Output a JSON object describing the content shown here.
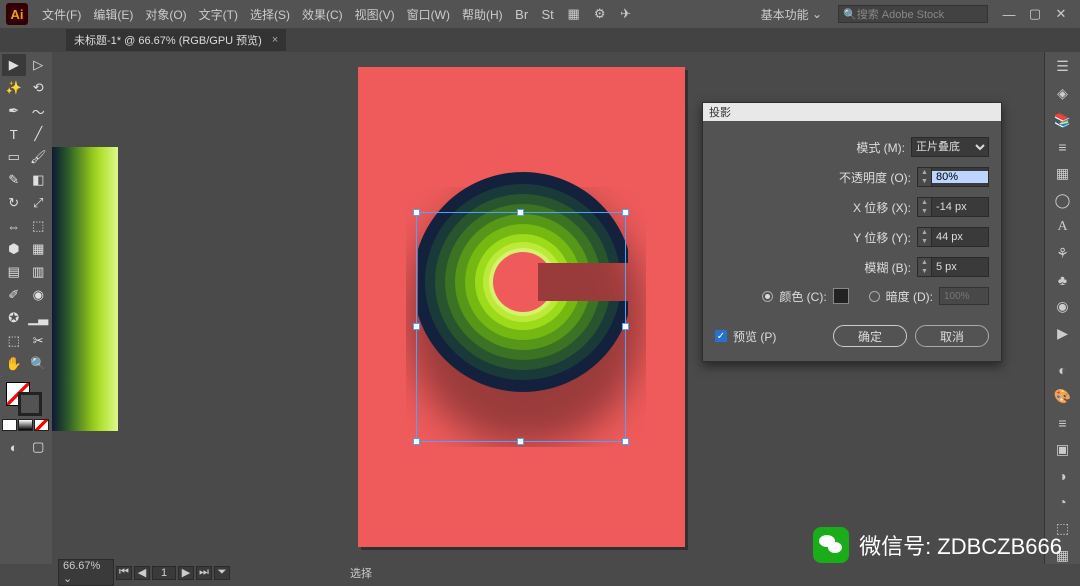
{
  "menu": {
    "items": [
      "文件(F)",
      "编辑(E)",
      "对象(O)",
      "文字(T)",
      "选择(S)",
      "效果(C)",
      "视图(V)",
      "窗口(W)",
      "帮助(H)"
    ],
    "workspace": "基本功能",
    "stock_placeholder": "搜索 Adobe Stock"
  },
  "tab": {
    "label": "未标题-1* @ 66.67% (RGB/GPU 预览)"
  },
  "dialog": {
    "title": "投影",
    "mode_label": "模式 (M):",
    "mode_value": "正片叠底",
    "opacity_label": "不透明度 (O):",
    "opacity_value": "80%",
    "xoffset_label": "X 位移 (X):",
    "xoffset_value": "-14 px",
    "yoffset_label": "Y 位移 (Y):",
    "yoffset_value": "44 px",
    "blur_label": "模糊 (B):",
    "blur_value": "5 px",
    "color_label": "颜色 (C):",
    "darkness_label": "暗度 (D):",
    "darkness_value": "100%",
    "preview_label": "预览 (P)",
    "ok": "确定",
    "cancel": "取消"
  },
  "status": {
    "zoom": "66.67%",
    "page": "1",
    "mode": "选择"
  },
  "overlay": {
    "text": "微信号: ZDBCZB666"
  }
}
